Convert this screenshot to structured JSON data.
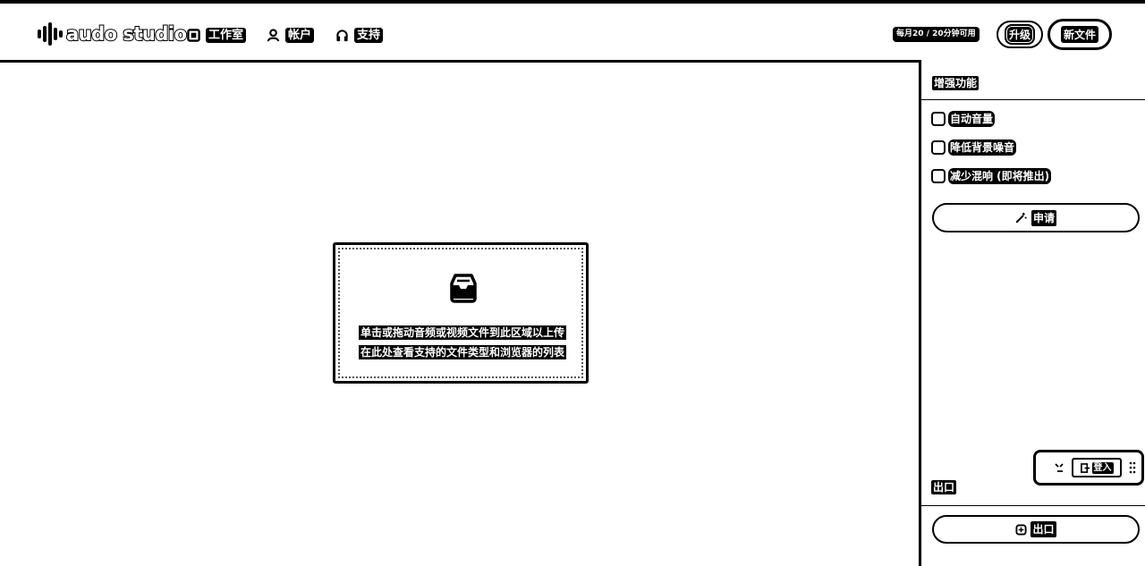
{
  "app": {
    "logo_text": "audo studio"
  },
  "nav": {
    "items": [
      {
        "label": "工作室",
        "icon": "studio-icon"
      },
      {
        "label": "帐户",
        "icon": "user-icon"
      },
      {
        "label": "支持",
        "icon": "headphones-icon"
      }
    ]
  },
  "header": {
    "quota_text": "每月20 / 20分钟可用",
    "upgrade_label": "升级",
    "new_file_label": "新文件"
  },
  "dropzone": {
    "icon": "inbox-icon",
    "line1": "单击或拖动音频或视频文件到此区域以上传",
    "line2": "在此处查看支持的文件类型和浏览器的列表"
  },
  "panel": {
    "title": "增强功能",
    "options": [
      {
        "label": "自动音量",
        "checked": false
      },
      {
        "label": "降低背景噪音",
        "checked": false
      },
      {
        "label": "减少混响 (即将推出)",
        "checked": false
      }
    ],
    "apply_label": "申请",
    "apply_icon": "magic-wand-icon",
    "floating_tool_label": "登入",
    "export_title": "出口",
    "export_label": "出口",
    "export_icon": "export-icon"
  },
  "colors": {
    "ink": "#000000",
    "paper": "#ffffff"
  }
}
